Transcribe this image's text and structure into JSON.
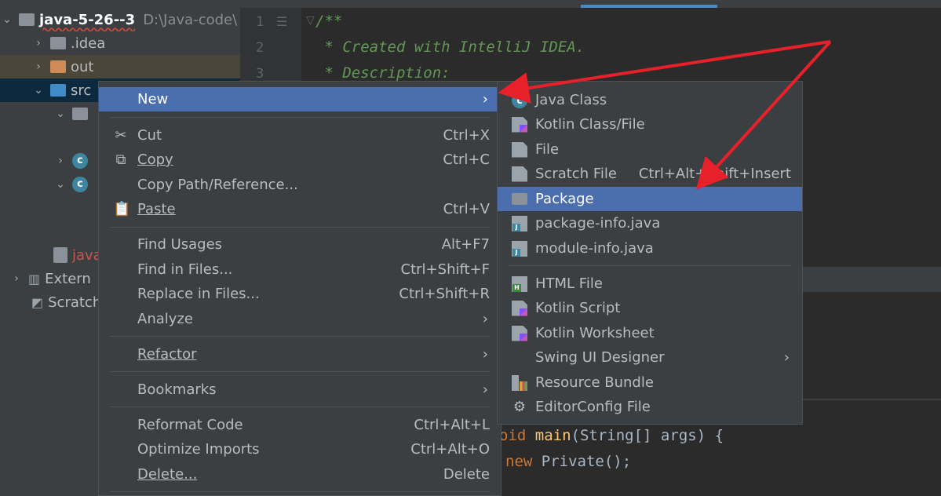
{
  "project_tree": {
    "root_name": "java-5-26--3",
    "root_path": "D:\\Java-code\\",
    "idea_label": ".idea",
    "out_label": "out",
    "src_label": "src",
    "java_file_label": "java",
    "external_label": "Extern",
    "scratch_label": "Scratch"
  },
  "editor": {
    "line_numbers": [
      "1",
      "2",
      "3"
    ],
    "lines": [
      "/**",
      " * Created with IntelliJ IDEA.",
      " * Description:"
    ],
    "main_kw_tail": "oid",
    "main_fn": "main",
    "main_rest": "(String[] args) {",
    "new_kw": "new",
    "new_rest": " Private();"
  },
  "context_menu": {
    "new": "New",
    "cut": "Cut",
    "cut_shortcut": "Ctrl+X",
    "copy": "Copy",
    "copy_shortcut": "Ctrl+C",
    "copy_path": "Copy Path/Reference...",
    "paste": "Paste",
    "paste_shortcut": "Ctrl+V",
    "find_usages": "Find Usages",
    "find_usages_shortcut": "Alt+F7",
    "find_in_files": "Find in Files...",
    "find_in_files_shortcut": "Ctrl+Shift+F",
    "replace_in_files": "Replace in Files...",
    "replace_in_files_shortcut": "Ctrl+Shift+R",
    "analyze": "Analyze",
    "refactor": "Refactor",
    "bookmarks": "Bookmarks",
    "reformat_code": "Reformat Code",
    "reformat_code_shortcut": "Ctrl+Alt+L",
    "optimize_imports": "Optimize Imports",
    "optimize_imports_shortcut": "Ctrl+Alt+O",
    "delete": "Delete...",
    "delete_shortcut": "Delete"
  },
  "new_submenu": {
    "java_class": "Java Class",
    "kotlin_class": "Kotlin Class/File",
    "file": "File",
    "scratch_file": "Scratch File",
    "scratch_file_shortcut": "Ctrl+Alt+Shift+Insert",
    "package": "Package",
    "package_info": "package-info.java",
    "module_info": "module-info.java",
    "html_file": "HTML File",
    "kotlin_script": "Kotlin Script",
    "kotlin_worksheet": "Kotlin Worksheet",
    "swing_ui_designer": "Swing UI Designer",
    "resource_bundle": "Resource Bundle",
    "editorconfig_file": "EditorConfig File"
  },
  "colors": {
    "highlight": "#4b6eaf",
    "annotation_arrow": "#e8202a"
  }
}
